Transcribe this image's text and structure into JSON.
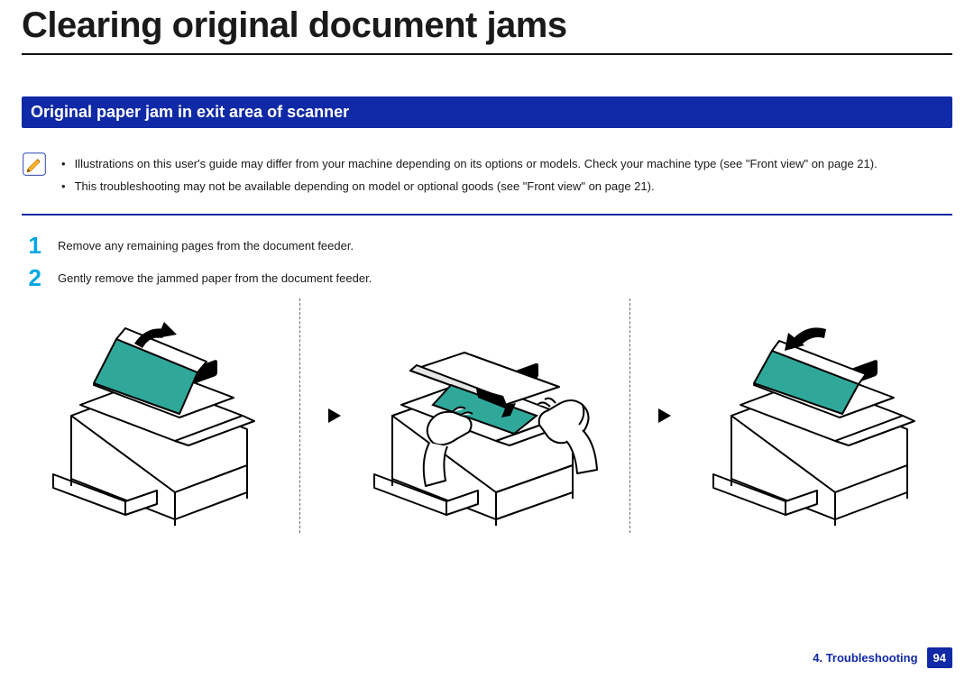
{
  "title": "Clearing original document jams",
  "section_heading": "Original paper jam in exit area of scanner",
  "notes": [
    "Illustrations on this user's guide may differ from your machine depending on its options or models. Check your machine type (see \"Front view\" on page 21).",
    "This troubleshooting may not be available depending on model or optional goods (see \"Front view\" on page 21)."
  ],
  "steps": [
    {
      "num": "1",
      "text": "Remove any remaining pages from the document feeder."
    },
    {
      "num": "2",
      "text": "Gently remove the jammed paper from the document feeder."
    }
  ],
  "footer": {
    "chapter": "4.  Troubleshooting",
    "page": "94"
  }
}
